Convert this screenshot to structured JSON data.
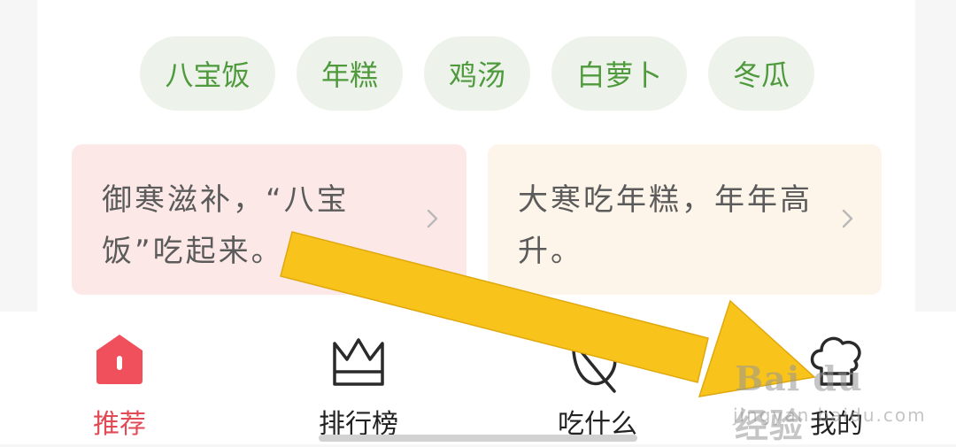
{
  "tags": [
    "八宝饭",
    "年糕",
    "鸡汤",
    "白萝卜",
    "冬瓜"
  ],
  "cards": [
    {
      "line1": "御寒滋补，“八宝",
      "line2": "饭”吃起来。",
      "chevron": "chevron-right-icon"
    },
    {
      "line1": "大寒吃年糕，年年高",
      "line2": "升。",
      "chevron": "chevron-right-icon"
    }
  ],
  "tabbar": {
    "active_index": 0,
    "items": [
      {
        "label": "推荐",
        "icon": "home-icon"
      },
      {
        "label": "排行榜",
        "icon": "crown-icon"
      },
      {
        "label": "吃什么",
        "icon": "leaf-icon"
      },
      {
        "label": "我的",
        "icon": "chef-hat-icon"
      }
    ]
  },
  "watermark": {
    "brand": "Bai du 经验",
    "sub": "jingyan.baidu.com"
  },
  "colors": {
    "accent": "#e24a56",
    "tag_text": "#4f9a3d",
    "tag_bg": "#edf3ea",
    "arrow": "#f8c41c"
  }
}
